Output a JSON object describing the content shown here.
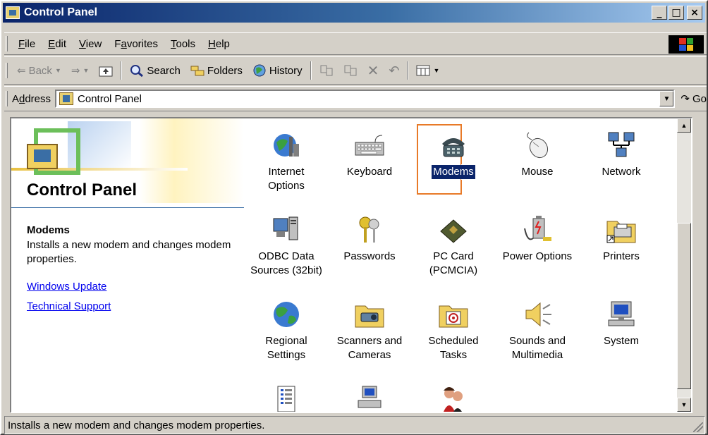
{
  "window": {
    "title": "Control Panel",
    "buttons": {
      "minimize": "_",
      "maximize": "□",
      "close": "×"
    }
  },
  "menu": [
    {
      "label": "File",
      "mnemonic": "F"
    },
    {
      "label": "Edit",
      "mnemonic": "E"
    },
    {
      "label": "View",
      "mnemonic": "V"
    },
    {
      "label": "Favorites",
      "mnemonic": "a"
    },
    {
      "label": "Tools",
      "mnemonic": "T"
    },
    {
      "label": "Help",
      "mnemonic": "H"
    }
  ],
  "toolbar": {
    "back": "Back",
    "search": "Search",
    "folders": "Folders",
    "history": "History"
  },
  "address": {
    "label": "Address",
    "value": "Control Panel",
    "go": "Go"
  },
  "left_pane": {
    "title": "Control Panel",
    "selected_name": "Modems",
    "selected_desc": "Installs a new modem and changes modem properties.",
    "links": [
      "Windows Update",
      "Technical Support"
    ]
  },
  "items": [
    {
      "label": "Internet\nOptions",
      "icon": "internet-options-icon"
    },
    {
      "label": "Keyboard",
      "icon": "keyboard-icon"
    },
    {
      "label": "Modems",
      "icon": "modem-phone-icon",
      "selected": true
    },
    {
      "label": "Mouse",
      "icon": "mouse-icon"
    },
    {
      "label": "Network",
      "icon": "network-icon"
    },
    {
      "label": "ODBC Data\nSources (32bit)",
      "icon": "odbc-icon"
    },
    {
      "label": "Passwords",
      "icon": "keys-icon"
    },
    {
      "label": "PC Card\n(PCMCIA)",
      "icon": "pc-card-icon"
    },
    {
      "label": "Power Options",
      "icon": "power-icon"
    },
    {
      "label": "Printers",
      "icon": "printers-folder-icon"
    },
    {
      "label": "Regional\nSettings",
      "icon": "globe-icon"
    },
    {
      "label": "Scanners and\nCameras",
      "icon": "scanner-folder-icon"
    },
    {
      "label": "Scheduled\nTasks",
      "icon": "scheduled-tasks-folder-icon"
    },
    {
      "label": "Sounds and\nMultimedia",
      "icon": "speaker-icon"
    },
    {
      "label": "System",
      "icon": "computer-icon"
    },
    {
      "label": "",
      "icon": "list-icon"
    },
    {
      "label": "",
      "icon": "users-computer-icon"
    },
    {
      "label": "",
      "icon": "users-icon"
    }
  ],
  "status": "Installs a new modem and changes modem properties."
}
